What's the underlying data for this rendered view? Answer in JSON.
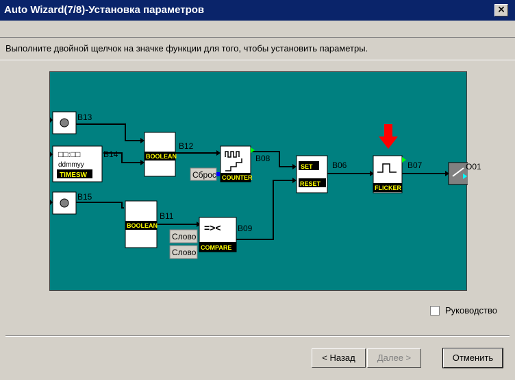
{
  "window": {
    "title": "Auto Wizard(7/8)-Установка параметров",
    "close_label": "×"
  },
  "instruction": "Выполните двойной щелчок на значке функции для того, чтобы установить параметры.",
  "diagram": {
    "background_color": "#008080",
    "inputs": [
      "B13",
      "B14",
      "B15"
    ],
    "timesw": {
      "time": "□□:□□",
      "date": "ddmmyy",
      "label": "TIMESW"
    },
    "blocks": {
      "boolean1": {
        "id": "B12",
        "label": "BOOLEAN"
      },
      "boolean2": {
        "id": "B11",
        "label": "BOOLEAN"
      },
      "counter": {
        "id": "B08",
        "label": "COUNTER",
        "reset_label": "Сброс"
      },
      "compare": {
        "id": "B09",
        "label": "COMPARE",
        "symbol": "=><",
        "word1": "Слово",
        "word2": "Слово"
      },
      "setreset": {
        "id": "B06",
        "set_label": "SET",
        "reset_label": "RESET"
      },
      "flicker": {
        "id": "B07",
        "label": "FLICKER"
      },
      "output": {
        "id": "O01"
      }
    },
    "arrow_color": "#ff0000"
  },
  "manual_checkbox": {
    "label": "Руководство",
    "checked": false
  },
  "buttons": {
    "back": "< Назад",
    "next": "Далее >",
    "cancel": "Отменить"
  }
}
